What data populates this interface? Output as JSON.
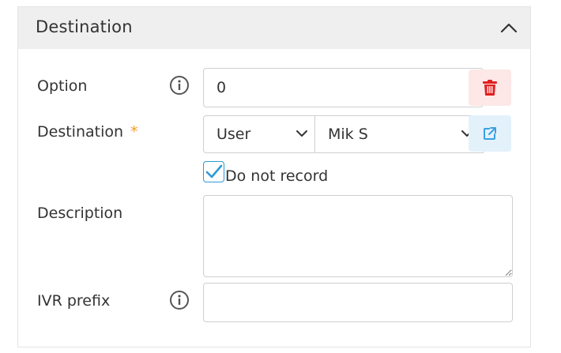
{
  "panel": {
    "title": "Destination"
  },
  "fields": {
    "option": {
      "label": "Option",
      "value": "0"
    },
    "destination": {
      "label": "Destination",
      "required_marker": "*",
      "type_value": "User",
      "target_value": "Mik S"
    },
    "do_not_record": {
      "label": "Do not record",
      "checked": true
    },
    "description": {
      "label": "Description",
      "value": ""
    },
    "ivr_prefix": {
      "label": "IVR prefix",
      "value": ""
    }
  },
  "icons": {
    "collapse": "chevron-up-icon",
    "info": "info-icon",
    "delete": "trash-icon",
    "open": "external-link-icon",
    "check": "checkmark-icon",
    "dropdown": "chevron-down-icon"
  },
  "colors": {
    "header_bg": "#efefef",
    "required": "#f0a020",
    "delete_icon": "#e02020",
    "delete_bg": "#fde7e7",
    "open_icon": "#3aa0e0",
    "open_bg": "#e3f1fb",
    "checkbox": "#2d9bd6"
  }
}
